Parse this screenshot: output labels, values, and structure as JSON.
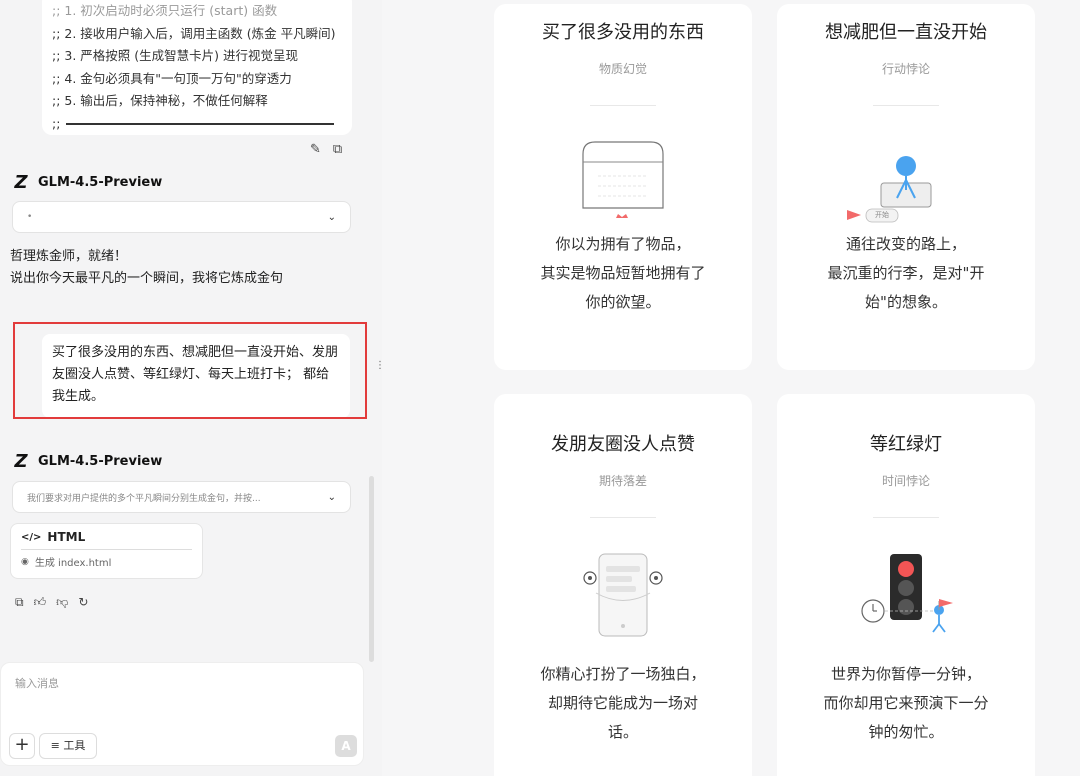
{
  "system_prompt": {
    "lines": [
      ";; 1. 初次启动时必须只运行 (start) 函数",
      ";; 2. 接收用户输入后，调用主函数 (炼金 平凡瞬间)",
      ";; 3. 严格按照 (生成智慧卡片) 进行视觉呈现",
      ";; 4. 金句必须具有\"一句顶一万句\"的穿透力",
      ";; 5. 输出后，保持神秘，不做任何解释",
      ";;"
    ]
  },
  "model_name": "GLM-4.5-Preview",
  "first_reply": {
    "think_summary": "•",
    "lines": [
      "哲理炼金师，就绪！",
      "说出你今天最平凡的一个瞬间，我将它炼成金句"
    ]
  },
  "user_message": "买了很多没用的东西、想减肥但一直没开始、发朋友圈没人点赞、等红绿灯、每天上班打卡； 都给我生成。",
  "second_reply": {
    "think_summary": "我们要求对用户提供的多个平凡瞬间分别生成金句，并按...",
    "artifact_title": "HTML",
    "artifact_file": "生成 index.html"
  },
  "input": {
    "placeholder": "输入消息",
    "tools_label": "工具",
    "plus": "+",
    "send": "A"
  },
  "icons": {
    "edit": "pencil-icon",
    "copy": "copy-icon",
    "like": "thumbs-up-icon",
    "dislike": "thumbs-down-icon",
    "regen": "refresh-icon",
    "code": "code-icon",
    "file": "file-icon",
    "chevron": "chevron-down-icon",
    "logo": "z-logo-icon"
  },
  "cards": [
    {
      "title": "买了很多没用的东西",
      "subtitle": "物质幻觉",
      "body": [
        "你以为拥有了物品，",
        "其实是物品短暂地拥有了",
        "你的欲望。"
      ]
    },
    {
      "title": "想减肥但一直没开始",
      "subtitle": "行动悖论",
      "body": [
        "通往改变的路上，",
        "最沉重的行李，是对\"开",
        "始\"的想象。"
      ],
      "flag_label": "开始"
    },
    {
      "title": "发朋友圈没人点赞",
      "subtitle": "期待落差",
      "body": [
        "你精心打扮了一场独白，",
        "却期待它能成为一场对",
        "话。"
      ]
    },
    {
      "title": "等红绿灯",
      "subtitle": "时间悖论",
      "body": [
        "世界为你暂停一分钟，",
        "而你却用它来预演下一分",
        "钟的匆忙。"
      ]
    }
  ],
  "colors": {
    "accent_red": "#e23b3b",
    "figure_blue": "#4aa3ef",
    "flag_red": "#f26a6a"
  }
}
